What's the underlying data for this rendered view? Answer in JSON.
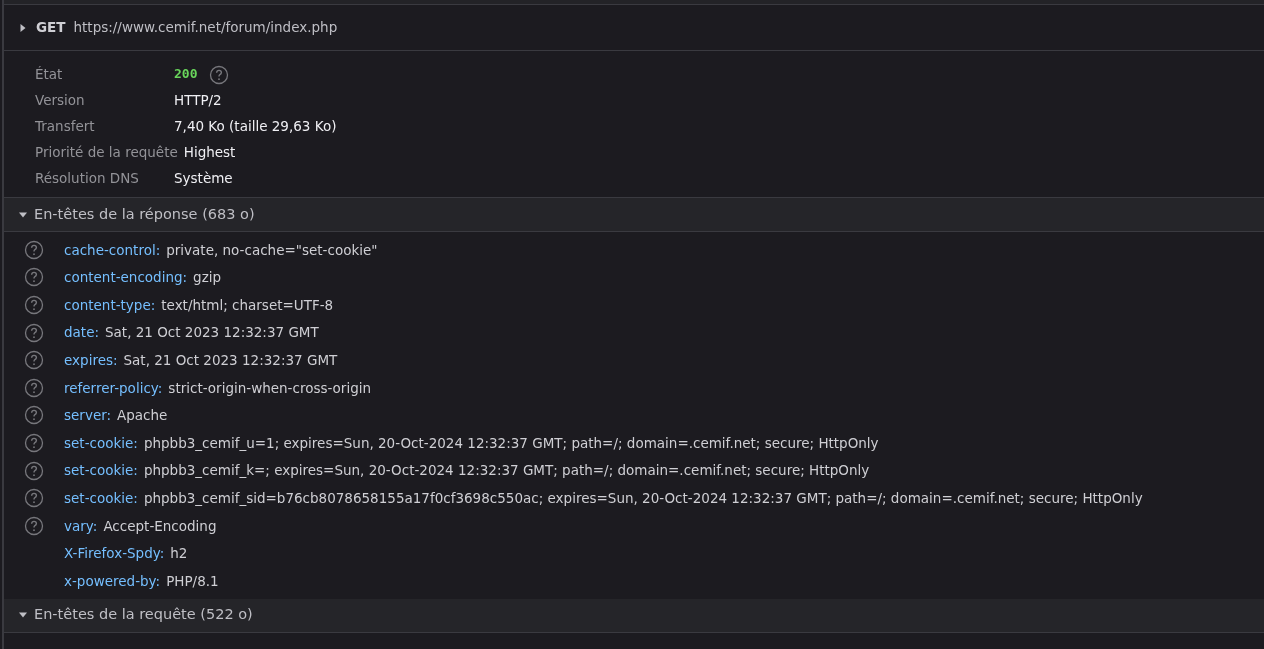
{
  "request": {
    "expanded": false,
    "method": "GET",
    "url": "https://www.cemif.net/forum/index.php"
  },
  "summary": [
    {
      "label": "État",
      "value": "200",
      "kind": "status"
    },
    {
      "label": "Version",
      "value": "HTTP/2",
      "kind": "text"
    },
    {
      "label": "Transfert",
      "value": "7,40 Ko (taille 29,63 Ko)",
      "kind": "text"
    },
    {
      "label": "Priorité de la requête",
      "value": "Highest",
      "kind": "text"
    },
    {
      "label": "Résolution DNS",
      "value": "Système",
      "kind": "text"
    }
  ],
  "response_headers": {
    "title": "En-têtes de la réponse (683 o)",
    "expanded": true,
    "headers": [
      {
        "name": "cache-control:",
        "value": "private, no-cache=\"set-cookie\"",
        "help": true
      },
      {
        "name": "content-encoding:",
        "value": "gzip",
        "help": true
      },
      {
        "name": "content-type:",
        "value": "text/html; charset=UTF-8",
        "help": true
      },
      {
        "name": "date:",
        "value": "Sat, 21 Oct 2023 12:32:37 GMT",
        "help": true
      },
      {
        "name": "expires:",
        "value": "Sat, 21 Oct 2023 12:32:37 GMT",
        "help": true
      },
      {
        "name": "referrer-policy:",
        "value": "strict-origin-when-cross-origin",
        "help": true
      },
      {
        "name": "server:",
        "value": "Apache",
        "help": true
      },
      {
        "name": "set-cookie:",
        "value": "phpbb3_cemif_u=1; expires=Sun, 20-Oct-2024 12:32:37 GMT; path=/; domain=.cemif.net; secure; HttpOnly",
        "help": true
      },
      {
        "name": "set-cookie:",
        "value": "phpbb3_cemif_k=; expires=Sun, 20-Oct-2024 12:32:37 GMT; path=/; domain=.cemif.net; secure; HttpOnly",
        "help": true
      },
      {
        "name": "set-cookie:",
        "value": "phpbb3_cemif_sid=b76cb8078658155a17f0cf3698c550ac; expires=Sun, 20-Oct-2024 12:32:37 GMT; path=/; domain=.cemif.net; secure; HttpOnly",
        "help": true
      },
      {
        "name": "vary:",
        "value": "Accept-Encoding",
        "help": true
      },
      {
        "name": "X-Firefox-Spdy:",
        "value": "h2",
        "help": false
      },
      {
        "name": "x-powered-by:",
        "value": "PHP/8.1",
        "help": false
      }
    ]
  },
  "request_headers": {
    "title": "En-têtes de la requête (522 o)",
    "expanded": true
  }
}
